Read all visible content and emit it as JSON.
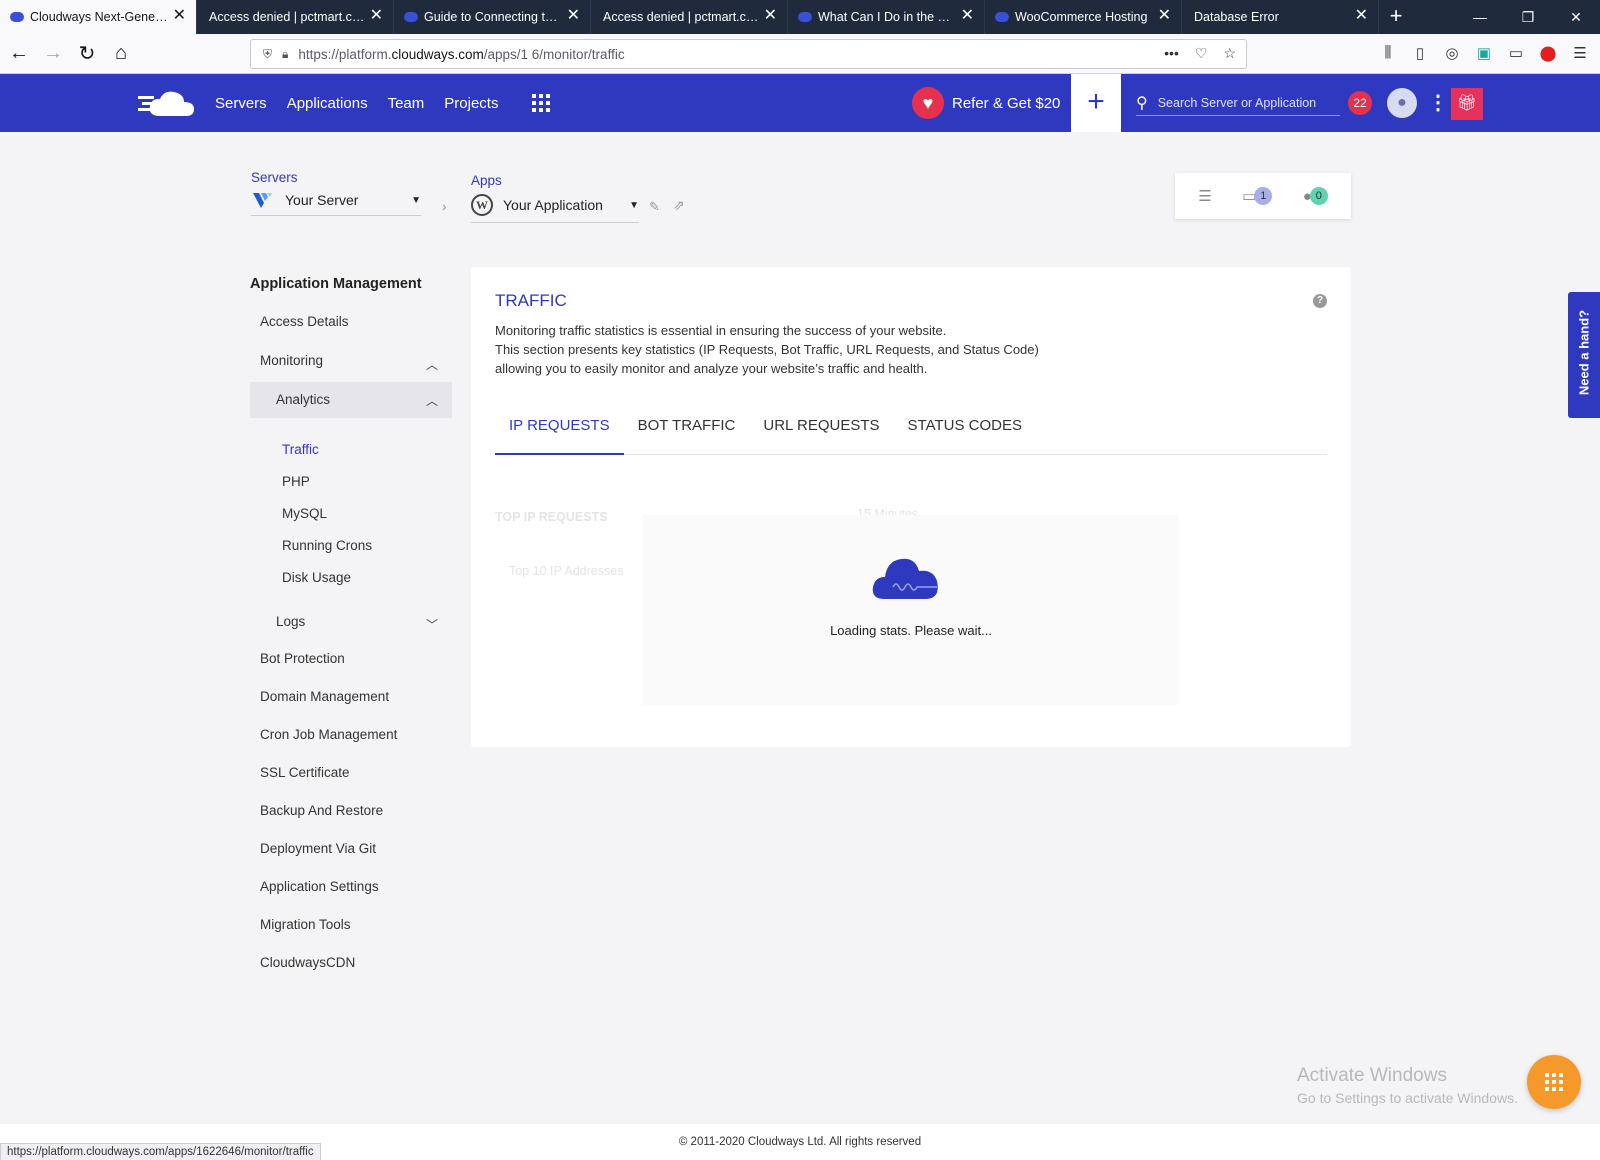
{
  "browser": {
    "tabs": [
      {
        "title": "Cloudways Next-Generati",
        "active": true,
        "favicon": true
      },
      {
        "title": "Access denied | pctmart.com",
        "active": false,
        "favicon": false
      },
      {
        "title": "Guide to Connecting to Yo",
        "active": false,
        "favicon": true
      },
      {
        "title": "Access denied | pctmart.com",
        "active": false,
        "favicon": false
      },
      {
        "title": "What Can I Do in the Man",
        "active": false,
        "favicon": true
      },
      {
        "title": "WooCommerce Hosting",
        "active": false,
        "favicon": true
      },
      {
        "title": "Database Error",
        "active": false,
        "favicon": false
      }
    ],
    "url_prefix": "https://platform.",
    "url_domain": "cloudways.com",
    "url_path": "/apps/1      6/monitor/traffic",
    "status_url": "https://platform.cloudways.com/apps/1622646/monitor/traffic"
  },
  "header": {
    "nav": [
      "Servers",
      "Applications",
      "Team",
      "Projects"
    ],
    "refer_label": "Refer & Get $20",
    "search_placeholder": "Search Server or Application",
    "notification_count": "22",
    "brand_color": "#2f39bf"
  },
  "breadcrumb": {
    "servers_label": "Servers",
    "server_name": "Your Server",
    "apps_label": "Apps",
    "app_name": "Your Application",
    "folder_count": "1",
    "user_count": "0"
  },
  "sidebar": {
    "title": "Application Management",
    "access_details": "Access Details",
    "monitoring": "Monitoring",
    "analytics": "Analytics",
    "analytics_items": [
      "Traffic",
      "PHP",
      "MySQL",
      "Running Crons",
      "Disk Usage"
    ],
    "logs": "Logs",
    "items": [
      "Bot Protection",
      "Domain Management",
      "Cron Job Management",
      "SSL Certificate",
      "Backup And Restore",
      "Deployment Via Git",
      "Application Settings",
      "Migration Tools",
      "CloudwaysCDN"
    ]
  },
  "main": {
    "title": "TRAFFIC",
    "desc1": "Monitoring traffic statistics is essential in ensuring the success of your website.",
    "desc2": "This section presents key statistics (IP Requests, Bot Traffic, URL Requests, and Status Code)",
    "desc3": "allowing you to easily monitor and analyze your website’s traffic and health.",
    "tabs": [
      "IP REQUESTS",
      "BOT TRAFFIC",
      "URL REQUESTS",
      "STATUS CODES"
    ],
    "faded_heading": "TOP IP REQUESTS",
    "faded_range": "15 Minutes",
    "faded_sub": "Top 10 IP Addresses",
    "loading_text": "Loading stats. Please wait..."
  },
  "need_hand": "Need a hand?",
  "watermark": {
    "line1": "Activate Windows",
    "line2": "Go to Settings to activate Windows."
  },
  "footer": "© 2011-2020 Cloudways Ltd. All rights reserved"
}
